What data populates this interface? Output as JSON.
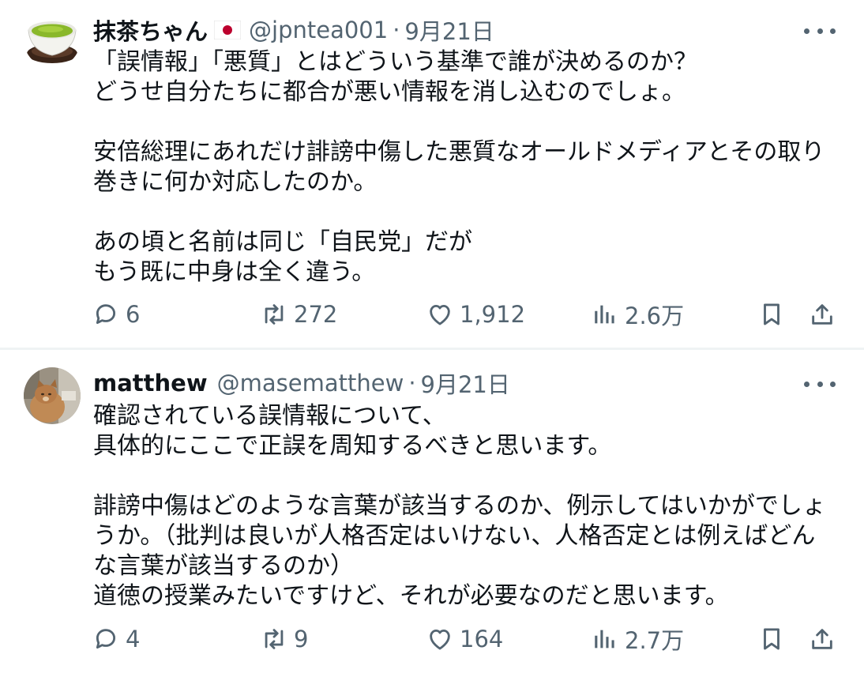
{
  "tweets": [
    {
      "name": "抹茶ちゃん",
      "handle": "@jpntea001",
      "separator": "·",
      "date": "9月21日",
      "text": "「誤情報」「悪質」とはどういう基準で誰が決めるのか？\nどうせ自分たちに都合が悪い情報を消し込むのでしょ。\n\n安倍総理にあれだけ誹謗中傷した悪質なオールドメディアとその取り\n巻きに何か対応したのか。\n\nあの頃と名前は同じ「自民党」だが\nもう既に中身は全く違う。",
      "replies": "6",
      "reposts": "272",
      "likes": "1,912",
      "views": "2.6万"
    },
    {
      "name": "matthew",
      "handle": "@masematthew",
      "separator": "·",
      "date": "9月21日",
      "text": "確認されている誤情報について、\n具体的にここで正誤を周知するべきと思います。\n\n誹謗中傷はどのような言葉が該当するのか、例示してはいかがでしょ\nうか。（批判は良いが人格否定はいけない、人格否定とは例えばどん\nな言葉が該当するのか）\n道徳の授業みたいですけど、それが必要なのだと思います。",
      "replies": "4",
      "reposts": "9",
      "likes": "164",
      "views": "2.7万"
    }
  ],
  "icons": {
    "reply": "reply-icon",
    "repost": "repost-icon",
    "like": "like-icon",
    "views": "views-icon",
    "bookmark": "bookmark-icon",
    "share": "share-icon",
    "more": "more-icon"
  },
  "colors": {
    "text": "#0f1419",
    "secondary": "#536471",
    "divider": "#eff3f4",
    "flag_red": "#bc002d"
  }
}
